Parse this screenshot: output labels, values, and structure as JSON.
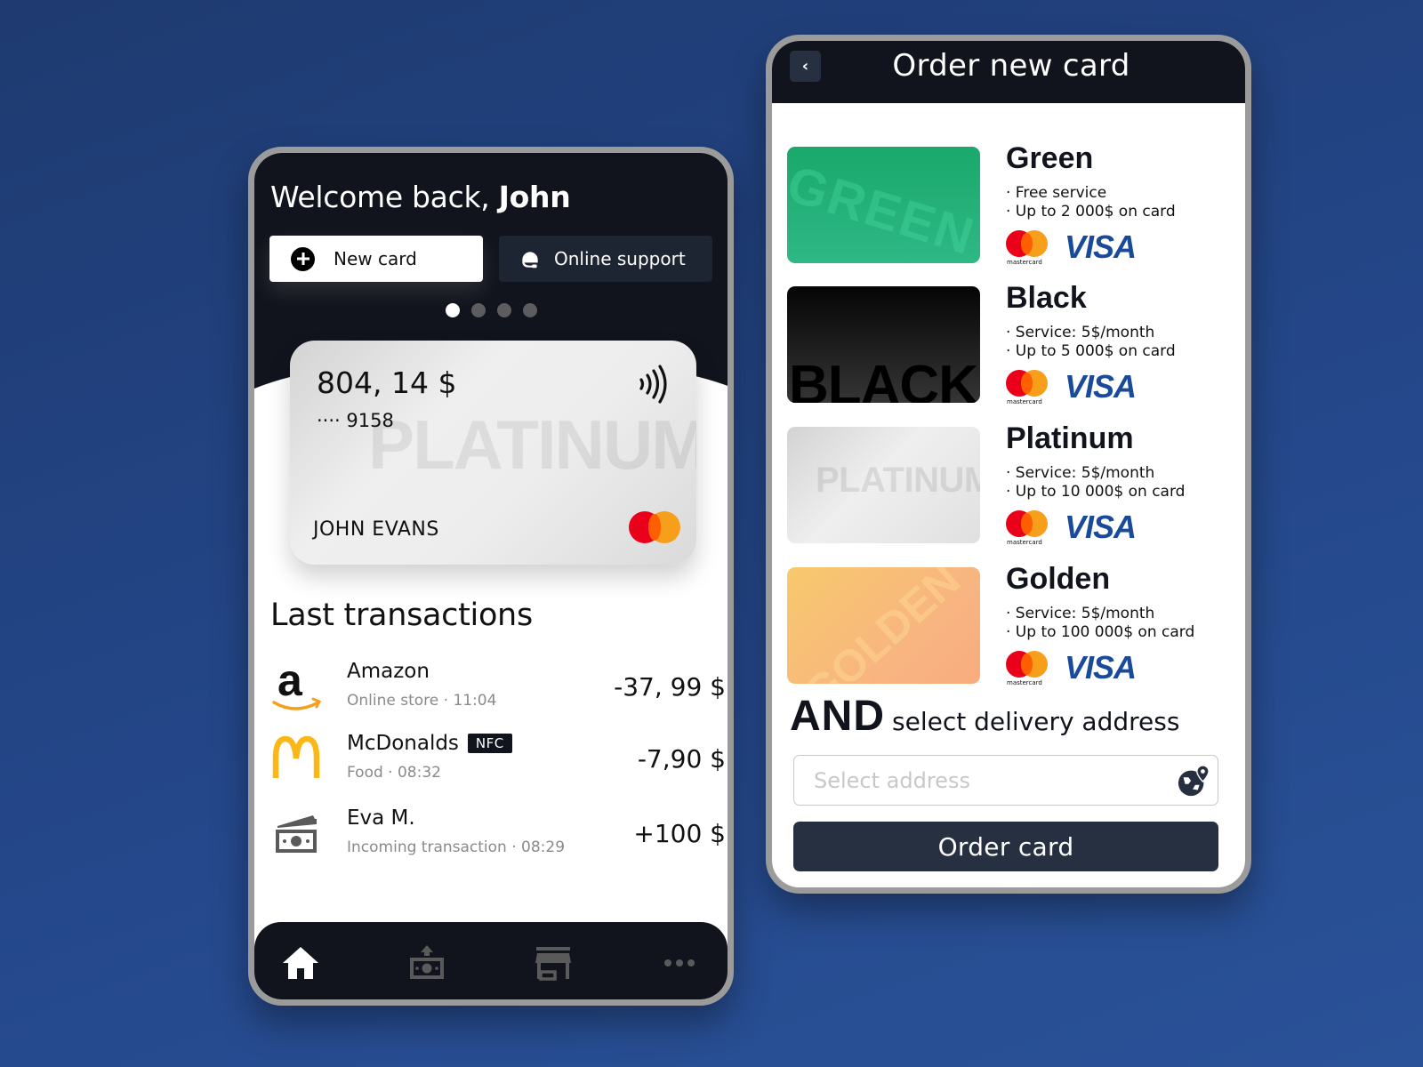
{
  "colors": {
    "background": "#24478a",
    "dark": "#11141c",
    "button_dark": "#263040",
    "mastercard_red": "#eb001b",
    "mastercard_yellow": "#f79e1b",
    "visa_blue": "#1a4a9a"
  },
  "home": {
    "welcome_prefix": "Welcome back, ",
    "welcome_name": "John",
    "buttons": {
      "new_card": "New card",
      "online_support": "Online support"
    },
    "carousel": {
      "count": 4,
      "active_index": 0
    },
    "card": {
      "balance": "804, 14 $",
      "number_masked": "···· 9158",
      "watermark": "PLATINUM",
      "holder": "JOHN EVANS",
      "network_icon": "mastercard-logo",
      "contactless_icon": "contactless-icon"
    },
    "transactions_title": "Last transactions",
    "transactions": [
      {
        "icon": "amazon-logo",
        "name": "Amazon",
        "badge": "",
        "sub": "Online store · 11:04",
        "amount": "-37, 99 $"
      },
      {
        "icon": "mcdonalds-logo",
        "name": "McDonalds",
        "badge": "NFC",
        "sub": "Food · 08:32",
        "amount": "-7,90 $"
      },
      {
        "icon": "cash-icon",
        "name": "Eva M.",
        "badge": "",
        "sub": "Incoming transaction · 08:29",
        "amount": "+100 $"
      }
    ],
    "nav": [
      {
        "icon": "home-icon",
        "active": true
      },
      {
        "icon": "transfer-money-icon",
        "active": false
      },
      {
        "icon": "store-icon",
        "active": false
      },
      {
        "icon": "more-icon",
        "active": false
      }
    ]
  },
  "order": {
    "title": "Order new card",
    "back_icon": "chevron-left-icon",
    "offers": [
      {
        "name": "Green",
        "watermark": "GREEN",
        "features": [
          "· Free service",
          "· Up to 2 000$ on card"
        ]
      },
      {
        "name": "Black",
        "watermark": "BLACK",
        "features": [
          "· Service: 5$/month",
          "· Up to 5 000$ on card"
        ]
      },
      {
        "name": "Platinum",
        "watermark": "PLATINUM",
        "features": [
          "· Service: 5$/month",
          "· Up to 10 000$ on card"
        ]
      },
      {
        "name": "Golden",
        "watermark": "GOLDEN",
        "features": [
          "· Service: 5$/month",
          "· Up to 100 000$ on card"
        ]
      }
    ],
    "networks": {
      "mastercard": "mastercard",
      "visa": "VISA"
    },
    "and_big": "AND",
    "and_small": "select delivery address",
    "address": {
      "value": "",
      "placeholder": "Select address"
    },
    "order_button": "Order card"
  }
}
